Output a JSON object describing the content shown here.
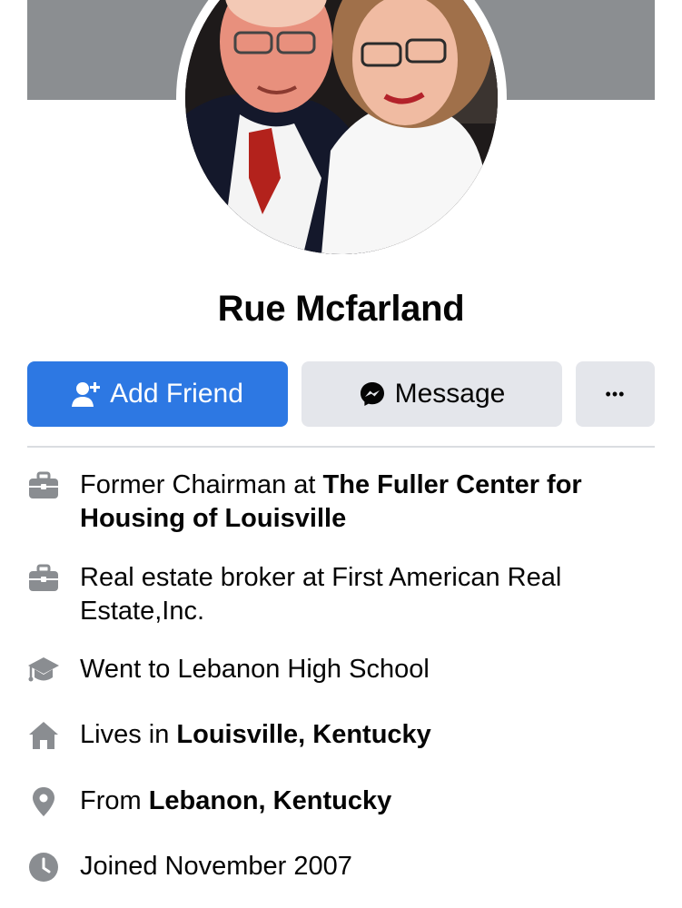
{
  "profile": {
    "name": "Rue Mcfarland",
    "avatar_alt": "Profile photo"
  },
  "actions": {
    "add_friend_label": "Add Friend",
    "message_label": "Message",
    "more_label": "•••"
  },
  "colors": {
    "cover": "#8b8e91",
    "primary_button": "#2d78e3",
    "secondary_button": "#e4e6eb",
    "icon": "#8a8d91",
    "divider": "#dadde1"
  },
  "intro": [
    {
      "icon": "briefcase-icon",
      "prefix": "Former Chairman at ",
      "strong": "The Fuller Center for Housing of Louisville"
    },
    {
      "icon": "briefcase-icon",
      "prefix": "Real estate broker at First American Real Estate,Inc.",
      "strong": ""
    },
    {
      "icon": "graduation-cap-icon",
      "prefix": "Went to Lebanon High School",
      "strong": ""
    },
    {
      "icon": "home-icon",
      "prefix": "Lives in ",
      "strong": "Louisville, Kentucky"
    },
    {
      "icon": "location-pin-icon",
      "prefix": "From ",
      "strong": "Lebanon, Kentucky"
    },
    {
      "icon": "clock-icon",
      "prefix": "Joined November 2007",
      "strong": ""
    }
  ]
}
